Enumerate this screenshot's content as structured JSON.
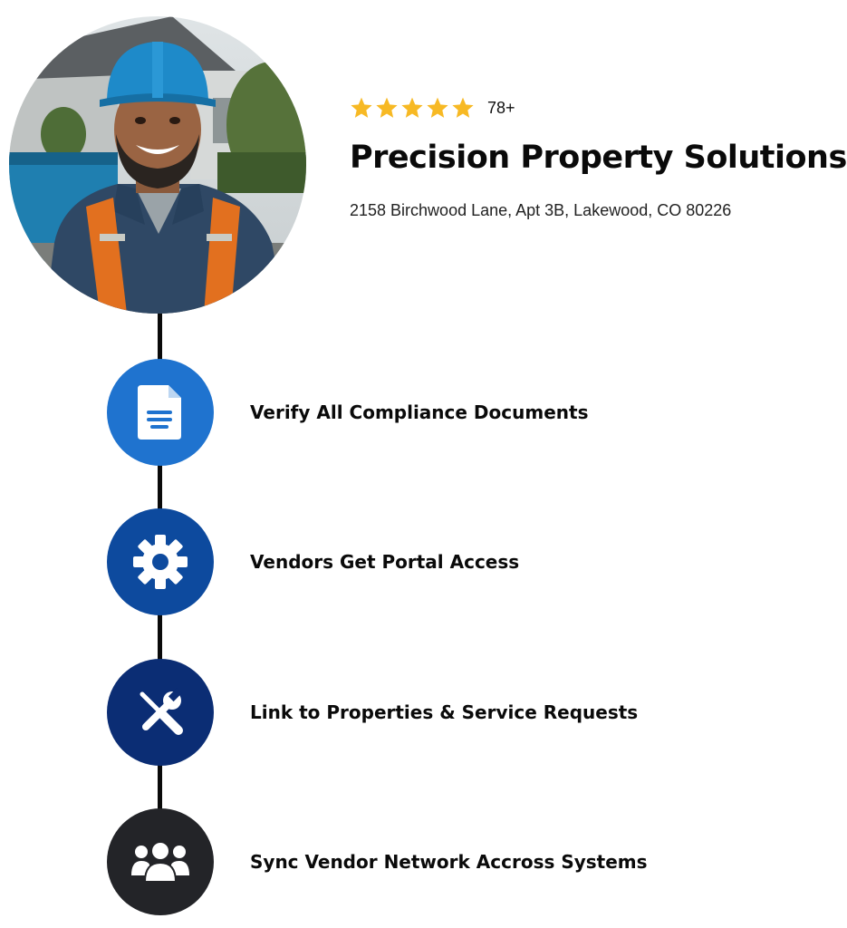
{
  "profile": {
    "photo": "smiling-worker-hard-hat-photo",
    "rating": {
      "stars": 5,
      "count_label": "78+"
    },
    "company_name": "Precision Property Solutions",
    "address": "2158 Birchwood Lane, Apt 3B, Lakewood, CO 80226"
  },
  "steps": [
    {
      "label": "Verify All Compliance Documents",
      "icon": "document-icon",
      "color": "#1f73cf"
    },
    {
      "label": "Vendors Get Portal Access",
      "icon": "gear-icon",
      "color": "#0d4a9e"
    },
    {
      "label": "Link to Properties & Service Requests",
      "icon": "tools-icon",
      "color": "#0b2d74"
    },
    {
      "label": "Sync Vendor Network Accross Systems",
      "icon": "users-icon",
      "color": "#232428"
    }
  ],
  "colors": {
    "star": "#f7b924",
    "timeline": "#0a0a0a"
  }
}
